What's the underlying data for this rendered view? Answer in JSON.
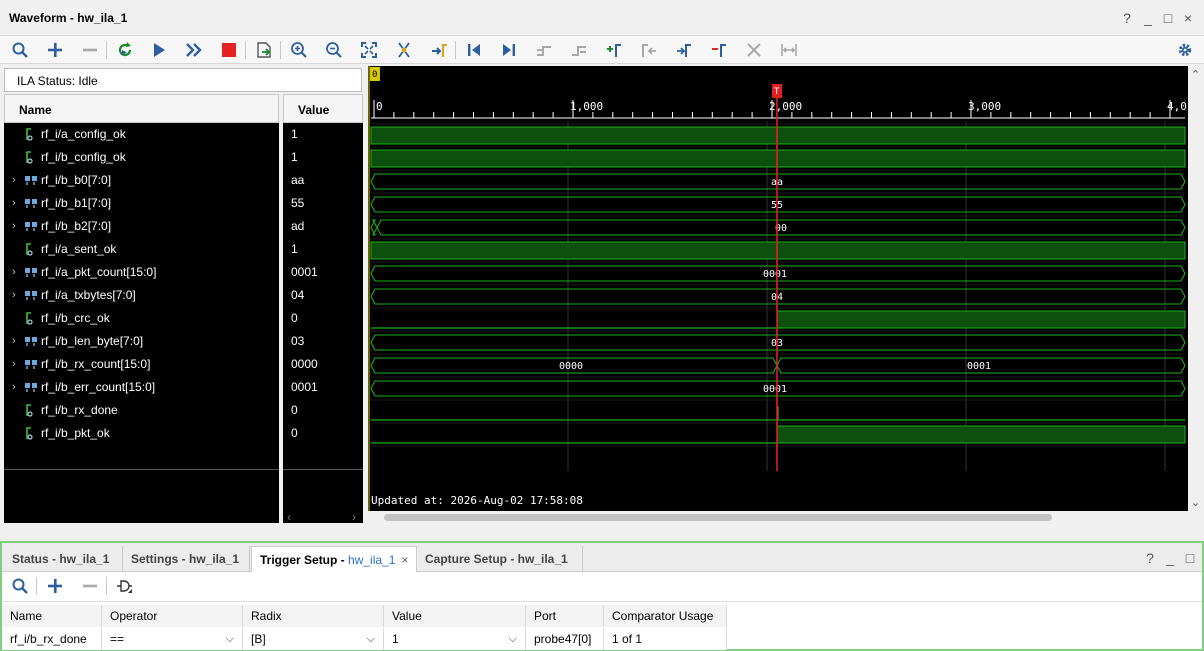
{
  "window": {
    "title": "Waveform - hw_ila_1",
    "controls": [
      "?",
      "_",
      "□",
      "×"
    ]
  },
  "toolbar_icons": [
    "search-icon",
    "add-icon",
    "remove-icon",
    "refresh-icon",
    "run-icon",
    "run-continuous-icon",
    "stop-icon",
    "export-icon",
    "zoom-in-icon",
    "zoom-out-icon",
    "zoom-fit-icon",
    "cursor-icon",
    "go-to-cursor-icon",
    "go-to-start-icon",
    "go-to-end-icon",
    "previous-transition-icon",
    "next-transition-icon",
    "add-marker-icon",
    "previous-marker-icon",
    "next-marker-icon",
    "swap-cursors-icon",
    "delete-icon",
    "expand-icon",
    "settings-gear-icon"
  ],
  "ila_status": "ILA Status: Idle",
  "columns": {
    "name": "Name",
    "value": "Value"
  },
  "signals": [
    {
      "name": "rf_i/a_config_ok",
      "value": "1",
      "bus": false
    },
    {
      "name": "rf_i/b_config_ok",
      "value": "1",
      "bus": false
    },
    {
      "name": "rf_i/b_b0[7:0]",
      "value": "aa",
      "bus": true
    },
    {
      "name": "rf_i/b_b1[7:0]",
      "value": "55",
      "bus": true
    },
    {
      "name": "rf_i/b_b2[7:0]",
      "value": "ad",
      "bus": true
    },
    {
      "name": "rf_i/a_sent_ok",
      "value": "1",
      "bus": false
    },
    {
      "name": "rf_i/a_pkt_count[15:0]",
      "value": "0001",
      "bus": true
    },
    {
      "name": "rf_i/a_txbytes[7:0]",
      "value": "04",
      "bus": true
    },
    {
      "name": "rf_i/b_crc_ok",
      "value": "0",
      "bus": false
    },
    {
      "name": "rf_i/b_len_byte[7:0]",
      "value": "03",
      "bus": true
    },
    {
      "name": "rf_i/b_rx_count[15:0]",
      "value": "0000",
      "bus": true
    },
    {
      "name": "rf_i/b_err_count[15:0]",
      "value": "0001",
      "bus": true
    },
    {
      "name": "rf_i/b_rx_done",
      "value": "0",
      "bus": false
    },
    {
      "name": "rf_i/b_pkt_ok",
      "value": "0",
      "bus": false
    }
  ],
  "waveform": {
    "origin_marker": "0",
    "trigger_marker": "T",
    "ruler_labels": [
      "0",
      "1,000",
      "2,000",
      "3,000",
      "4,0"
    ],
    "bus_labels": [
      {
        "row": 2,
        "text": "aa"
      },
      {
        "row": 3,
        "text": "55"
      },
      {
        "row": 4,
        "text": "00"
      },
      {
        "row": 6,
        "text": "0001"
      },
      {
        "row": 7,
        "text": "04"
      },
      {
        "row": 9,
        "text": "03"
      },
      {
        "row": 10,
        "text": "0000"
      },
      {
        "row": 10,
        "text": "0001"
      },
      {
        "row": 11,
        "text": "0001"
      }
    ],
    "updated_text": "Updated at: 2026-Aug-02 17:58:08",
    "wave_color": "#1ab01a",
    "trigger_color": "#e02020"
  },
  "bottom": {
    "tabs": [
      {
        "label": "Status - hw_ila_1",
        "active": false
      },
      {
        "label": "Settings - hw_ila_1",
        "active": false
      },
      {
        "label": "Trigger Setup - ",
        "sub": "hw_ila_1",
        "active": true
      },
      {
        "label": "Capture Setup - hw_ila_1",
        "active": false
      }
    ],
    "controls": [
      "?",
      "_",
      "□"
    ],
    "table": {
      "headers": [
        "Name",
        "Operator",
        "Radix",
        "Value",
        "Port",
        "Comparator Usage"
      ],
      "row": [
        "rf_i/b_rx_done",
        "==",
        "[B]",
        "1",
        "probe47[0]",
        "1 of 1"
      ]
    }
  }
}
